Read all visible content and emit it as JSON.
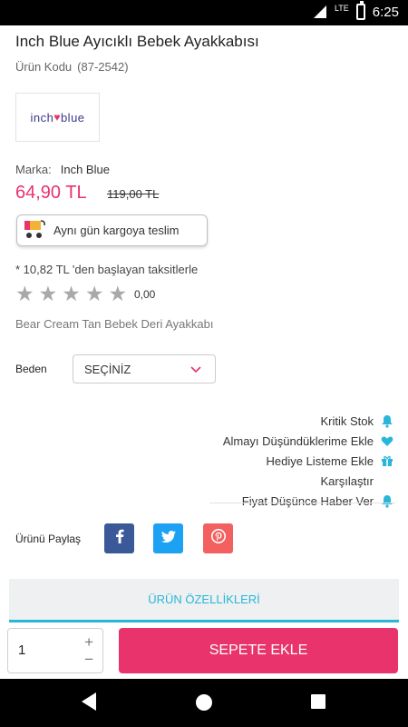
{
  "status_bar": {
    "time": "6:25",
    "network": "LTE"
  },
  "product": {
    "title": "Inch Blue Ayıcıklı Bebek Ayakkabısı",
    "code_label": "Ürün Kodu",
    "code_value": "(87-2542)",
    "brand_logo_text_left": "inch",
    "brand_logo_text_right": "blue",
    "brand_label": "Marka:",
    "brand_value": "Inch Blue",
    "price": "64,90 TL",
    "old_price": "119,00 TL",
    "cargo_text": "Aynı gün kargoya teslim",
    "installment_text": "* 10,82 TL 'den başlayan taksitlerle",
    "rating_value": "0,00",
    "rating_stars": 0,
    "description": "Bear Cream Tan Bebek Deri Ayakkabı"
  },
  "size": {
    "label": "Beden",
    "selected": "SEÇİNİZ"
  },
  "actions": [
    {
      "label": "Kritik Stok",
      "icon": "bell-icon"
    },
    {
      "label": "Almayı Düşündüklerime Ekle",
      "icon": "heart-icon"
    },
    {
      "label": "Hediye Listeme Ekle",
      "icon": "gift-icon"
    },
    {
      "label": "Karşılaştır",
      "icon": ""
    },
    {
      "label": "Fiyat Düşünce Haber Ver",
      "icon": "bell-icon"
    }
  ],
  "share": {
    "label": "Ürünü Paylaş",
    "networks": [
      "facebook",
      "twitter",
      "pinterest"
    ]
  },
  "features_tab": {
    "label": "ÜRÜN ÖZELLİKLERİ"
  },
  "cart": {
    "quantity": "1",
    "add_label": "SEPETE EKLE"
  },
  "colors": {
    "accent": "#e8336c",
    "tab": "#29b6d8",
    "icon_blue": "#29b6d8",
    "star": "#a9a9a9"
  }
}
